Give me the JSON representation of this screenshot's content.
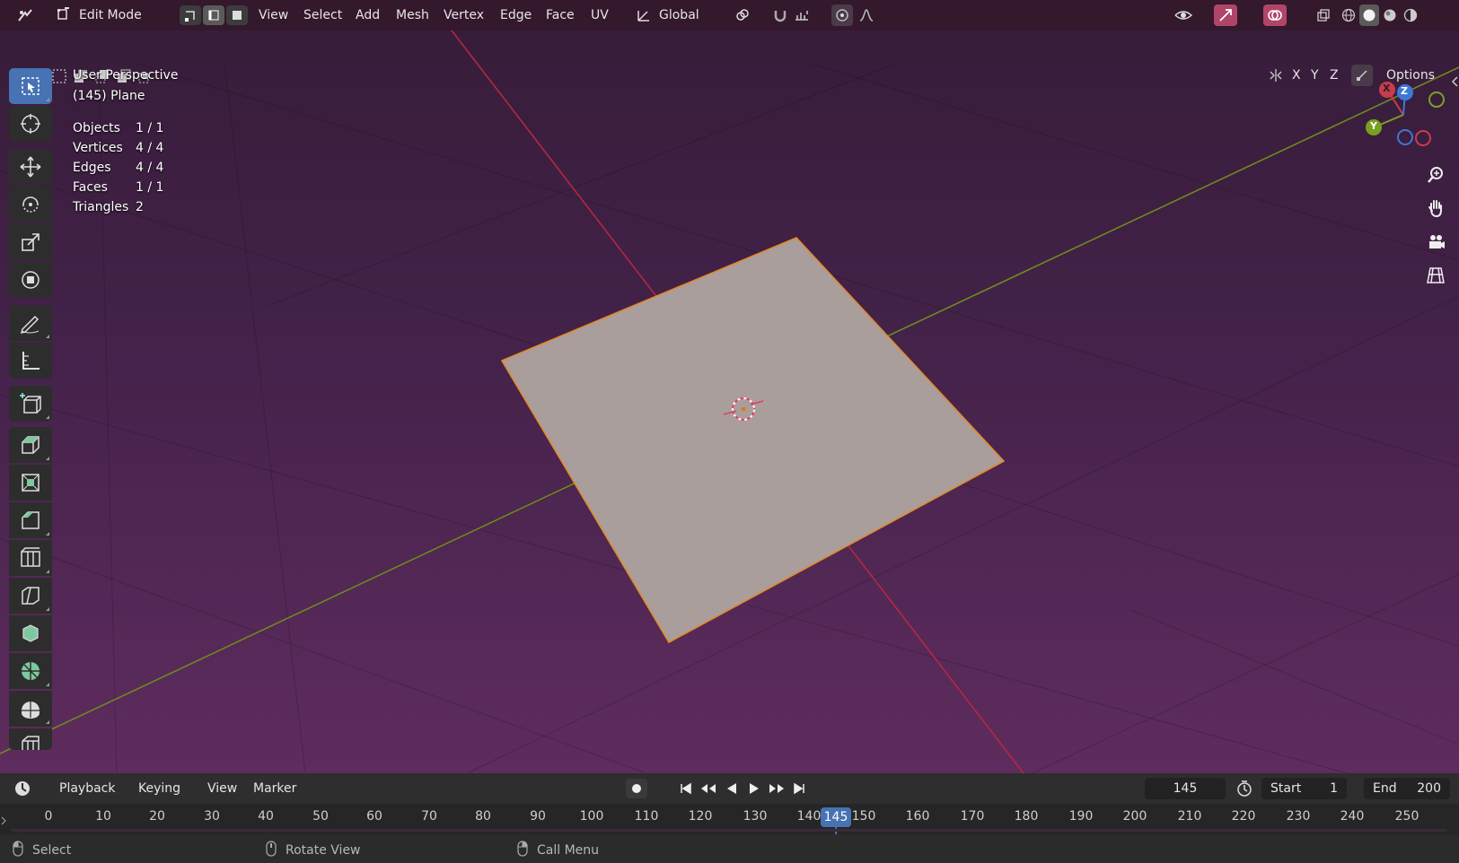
{
  "header": {
    "mode": "Edit Mode",
    "menus": [
      "View",
      "Select",
      "Add",
      "Mesh",
      "Vertex",
      "Edge",
      "Face",
      "UV"
    ],
    "transform_orientation": "Global",
    "axes": [
      "X",
      "Y",
      "Z"
    ],
    "options": "Options"
  },
  "overlay": {
    "view_name": "User Perspective",
    "object_name": "(145) Plane",
    "stats": [
      {
        "label": "Objects",
        "value": "1 / 1"
      },
      {
        "label": "Vertices",
        "value": "4 / 4"
      },
      {
        "label": "Edges",
        "value": "4 / 4"
      },
      {
        "label": "Faces",
        "value": "1 / 1"
      },
      {
        "label": "Triangles",
        "value": "2"
      }
    ]
  },
  "gizmo": {
    "x": "X",
    "y": "Y",
    "z": "Z"
  },
  "timeline": {
    "menus": [
      "Playback",
      "Keying",
      "View",
      "Marker"
    ],
    "current_frame": "145",
    "start_label": "Start",
    "start_value": "1",
    "end_label": "End",
    "end_value": "200",
    "ticks": [
      "0",
      "10",
      "20",
      "30",
      "40",
      "50",
      "60",
      "70",
      "80",
      "90",
      "100",
      "110",
      "120",
      "130",
      "140",
      "150",
      "160",
      "170",
      "180",
      "190",
      "200",
      "210",
      "220",
      "230",
      "240",
      "250"
    ],
    "playhead": "145"
  },
  "statusbar": {
    "select": "Select",
    "rotate": "Rotate View",
    "call_menu": "Call Menu"
  },
  "colors": {
    "accent": "#4772b3",
    "x_axis": "#c83c50",
    "y_axis": "#6b8e23",
    "z_axis": "#3c78d8"
  }
}
